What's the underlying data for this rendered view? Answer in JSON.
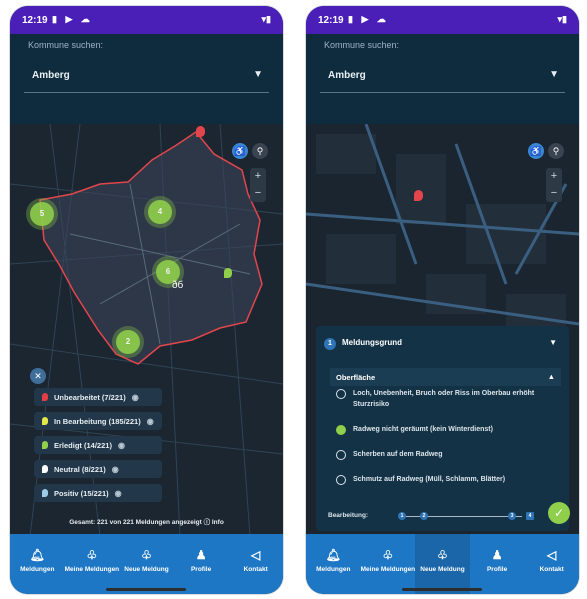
{
  "phone1": {
    "status": {
      "time": "12:19",
      "left_icons": "▮ ▶ ☁",
      "right_icons": "▾▮"
    },
    "kommune_label": "Kommune suchen:",
    "kommune_value": "Amberg",
    "clusters": [
      "5",
      "4",
      "6",
      "2"
    ],
    "legend": [
      {
        "label": "Unbearbeitet (7/221)",
        "color": "#e63c43"
      },
      {
        "label": "In Bearbeitung (185/221)",
        "color": "#e3e84a"
      },
      {
        "label": "Erledigt (14/221)",
        "color": "#8fcf4b"
      },
      {
        "label": "Neutral (8/221)",
        "color": "#ffffff"
      },
      {
        "label": "Positiv (15/221)",
        "color": "#9ecbe8"
      }
    ],
    "footer_note": "Gesamt: 221 von 221 Meldungen angezeigt  ⓘ Info",
    "nav": [
      {
        "label": "Meldungen",
        "icon": "bell-icon"
      },
      {
        "label": "Meine Meldungen",
        "icon": "bell-plus-icon"
      },
      {
        "label": "Neue Meldung",
        "icon": "bell-add-icon"
      },
      {
        "label": "Profile",
        "icon": "person-icon"
      },
      {
        "label": "Kontakt",
        "icon": "megaphone-icon"
      }
    ]
  },
  "phone2": {
    "status": {
      "time": "12:19",
      "left_icons": "▮ ▶ ☁",
      "right_icons": "▾▮"
    },
    "kommune_label": "Kommune suchen:",
    "kommune_value": "Amberg",
    "panel": {
      "step": "1",
      "title": "Meldungsgrund",
      "sub_title": "Oberfläche",
      "options": [
        {
          "text": "Loch, Unebenheit, Bruch oder Riss im Oberbau erhöht Sturzrisiko",
          "selected": false
        },
        {
          "text": "Radweg nicht geräumt (kein Winterdienst)",
          "selected": true
        },
        {
          "text": "Scherben auf dem Radweg",
          "selected": false
        },
        {
          "text": "Schmutz auf Radweg (Müll, Schlamm, Blätter)",
          "selected": false
        }
      ],
      "progress_label": "Bearbeitung:",
      "progress_steps": [
        "1",
        "2",
        "3",
        "4"
      ],
      "progress_fraction": 0.25
    },
    "nav": [
      {
        "label": "Meldungen",
        "icon": "bell-icon"
      },
      {
        "label": "Meine Meldungen",
        "icon": "bell-plus-icon"
      },
      {
        "label": "Neue Meldung",
        "icon": "bell-add-icon"
      },
      {
        "label": "Profile",
        "icon": "person-icon"
      },
      {
        "label": "Kontakt",
        "icon": "megaphone-icon"
      }
    ]
  }
}
